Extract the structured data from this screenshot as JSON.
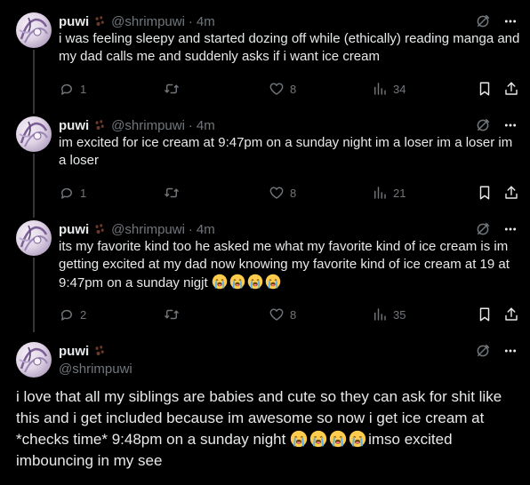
{
  "colors": {
    "background": "#000000",
    "text": "#e7e9ea",
    "muted": "#71767b",
    "line": "#333639"
  },
  "tweets": [
    {
      "name": "puwi",
      "handle": "@shrimpuwi",
      "separator": "·",
      "time": "4m",
      "text": "i was feeling sleepy and started dozing off while (ethically) reading manga and my dad calls me and suddenly asks if i want ice cream",
      "emoji_suffix_count": 0,
      "replies": "1",
      "likes": "8",
      "views": "34"
    },
    {
      "name": "puwi",
      "handle": "@shrimpuwi",
      "separator": "·",
      "time": "4m",
      "text": "im excited for ice cream at 9:47pm on a sunday night im a loser im a loser im a loser",
      "emoji_suffix_count": 0,
      "replies": "1",
      "likes": "8",
      "views": "21"
    },
    {
      "name": "puwi",
      "handle": "@shrimpuwi",
      "separator": "·",
      "time": "4m",
      "text": "its my favorite kind too he asked me what my favorite kind of ice cream is im getting excited at my dad now knowing my favorite kind of ice cream at 19 at 9:47pm on a sunday nigjt ",
      "emoji_suffix_count": 4,
      "replies": "2",
      "likes": "8",
      "views": "35"
    }
  ],
  "main_tweet": {
    "name": "puwi",
    "handle": "@shrimpuwi",
    "text_before": "i love that all my siblings are babies and cute so they can ask for shit like this and i get included because im awesome so now i get ice cream at *checks time* 9:48pm on a sunday night ",
    "emoji_count": 4,
    "text_after": "imso excited imbouncing in my see"
  },
  "icons": {
    "reply": "reply-bubble-icon",
    "retweet": "retweet-icon",
    "like": "heart-icon",
    "views": "views-bar-chart-icon",
    "bookmark": "bookmark-icon",
    "share": "share-icon",
    "grok": "grok-icon",
    "more": "more-dots-icon",
    "paw": "paw-emoji-icon",
    "crying": "loudly-crying-face-emoji"
  }
}
